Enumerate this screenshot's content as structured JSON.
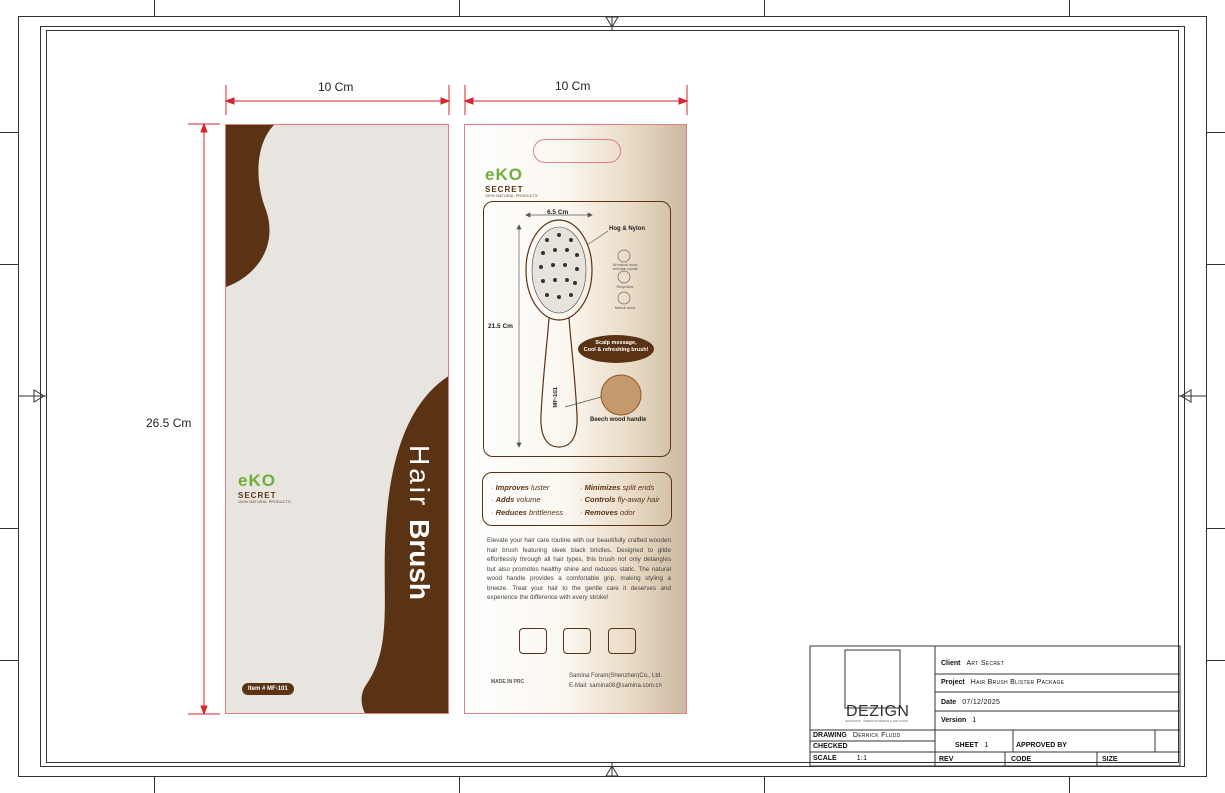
{
  "dimensions": {
    "front_width": "10 Cm",
    "back_width": "10 Cm",
    "height": "26.5 Cm"
  },
  "front": {
    "logo": {
      "eko": "eKO",
      "secret": "SECRET",
      "tagline": "100% NATURAL PRODUCTS"
    },
    "title_light": "Hair ",
    "title_bold": "Brush",
    "item_badge": "Item # MF-101"
  },
  "back": {
    "logo": {
      "eko": "eKO",
      "secret": "SECRET",
      "tagline": "100% NATURAL PRODUCTS"
    },
    "width_label": "6.5 Cm",
    "length_label": "21.5 Cm",
    "bristle_label": "Hog & Nylon",
    "model_label": "MF-101",
    "cert_1": "All natural wood selection crystal",
    "cert_2": "Recyclable",
    "cert_3": "Natural wood",
    "scalp_line1": "Scalp message,",
    "scalp_line2": "Cool & refreshing brush!",
    "handle_label": "Beech wood handle",
    "features": {
      "f1_bold": "Improves",
      "f1_rest": " luster",
      "f2_bold": "Adds",
      "f2_rest": " volume",
      "f3_bold": "Reduces",
      "f3_rest": " brittleness",
      "f4_bold": "Minimizes",
      "f4_rest": " split ends",
      "f5_bold": "Controls",
      "f5_rest": " fly-away hair",
      "f6_bold": "Removes",
      "f6_rest": " odor"
    },
    "description": "Elevate your hair care routine with our beautifully crafted wooden hair brush featuring sleek black bristles. Designed to glide effortlessly through all hair types, this brush not only detangles but also promotes healthy shine and reduces static. The natural wood handle provides a comfortable grip, making styling a breeze. Treat your hair to the gentle care it deserves and experience the difference with every stroke!",
    "made_in": "MADE IN PRC",
    "company": "Samina Foram(Shenzhen)Co., Ltd.",
    "email": "E-Mail: samina08@samina.com.cn"
  },
  "title_block": {
    "brand": "DEZIGN",
    "brand_sub": "GRAPHICS · WEBSITE DESIGN & SOLUTION",
    "client_label": "Client",
    "client": "Art Secret",
    "project_label": "Project",
    "project": "Hair Brush Blister Package",
    "date_label": "Date",
    "date": "07/12/2025",
    "version_label": "Version",
    "version": "1",
    "drawing_label": "DRAWING",
    "drawing": "Derrick Fludd",
    "checked_label": "CHECKED",
    "scale_label": "SCALE",
    "scale": "1:1",
    "sheet_label": "SHEET",
    "sheet": "1",
    "approved_label": "APPROVED BY",
    "rev_label": "REV",
    "code_label": "CODE",
    "size_label": "SIZE"
  },
  "colors": {
    "brown": "#5a3314",
    "green": "#6fae3a",
    "dim_red": "#d9232e",
    "panel_bg": "#e8e4df"
  }
}
